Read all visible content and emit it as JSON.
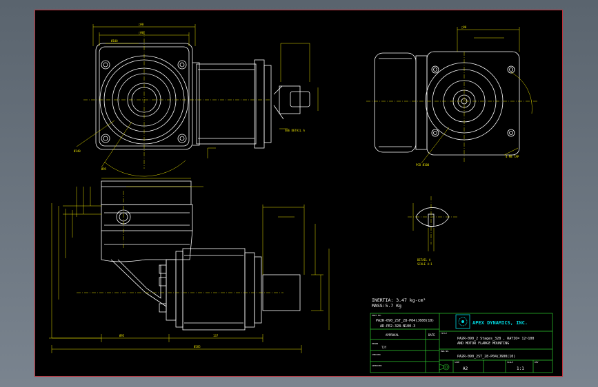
{
  "colors": {
    "background": "#000000",
    "geometry": "#ffffff",
    "dimensions": "#e8e000",
    "title_block": "#30d030",
    "logo": "#00d8e0",
    "frame": "#c0303a"
  },
  "notes": {
    "inertia": "INERTIA: 3.47 kg-cm²",
    "mass": "MASS:5.7 Kg"
  },
  "title_block": {
    "part_no_label": "PART NO.",
    "part_no_line1": "PA2R-090_2ST_28-P04(J600(10)",
    "part_no_line2": "AD-PE2-328-N100-3",
    "approval_label": "APPROVAL",
    "date_label": "DATE",
    "drawn_label": "DRAWN",
    "drawn_value": "TJY",
    "checked_label": "CHECKED",
    "approved_label": "APPROVED",
    "company": "APEX DYNAMICS, INC.",
    "title_label": "TITLE",
    "title_line1": "PA2R-090_2 Stages_328 , RATIO= 12~100",
    "title_line2": "AND MOTOR FLANGE MOUNTING",
    "dwg_no_label": "DWG NO.",
    "dwg_no_value": "PA2R-090_2ST_28-P04(J600(10)",
    "size_label": "SIZE",
    "size_value": "A2",
    "scale_label": "SCALE",
    "scale_value": "1:1",
    "rev_label": "REV"
  },
  "labels": {
    "detail_a": "SEE DETAIL A",
    "detail_caption1": "DETAIL A",
    "detail_caption2": "SCALE 4:1",
    "pcd_label": "PCD Ø100",
    "thread_label": "4-M8 TAP",
    "dim_overall": "Ø285",
    "dim_95": "Ø95",
    "dim_137": "137",
    "dim_90a": "□90",
    "dim_90b": "□90",
    "dim_90c": "□90",
    "dim_100": "Ø100",
    "dim_140": "Ø140"
  }
}
